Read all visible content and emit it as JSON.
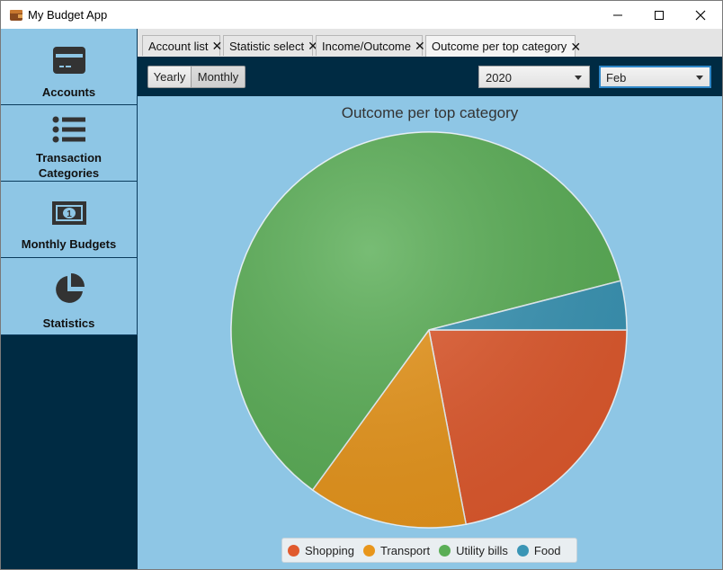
{
  "window": {
    "title": "My Budget App"
  },
  "sidebar": {
    "items": [
      {
        "label_lines": [
          "Accounts"
        ],
        "icon": "card-icon"
      },
      {
        "label_lines": [
          "Transaction",
          "Categories"
        ],
        "icon": "list-icon"
      },
      {
        "label_lines": [
          "Monthly Budgets"
        ],
        "icon": "banknote-icon"
      },
      {
        "label_lines": [
          "Statistics"
        ],
        "icon": "pie-icon"
      }
    ]
  },
  "tabs": [
    {
      "label": "Account list"
    },
    {
      "label": "Statistic select"
    },
    {
      "label": "Income/Outcome"
    },
    {
      "label": "Outcome per top category",
      "active": true
    }
  ],
  "toolbar": {
    "yearly_label": "Yearly",
    "monthly_label": "Monthly",
    "year_value": "2020",
    "month_value": "Feb"
  },
  "chart_data": {
    "type": "pie",
    "title": "Outcome per top category",
    "slices": [
      {
        "name": "Shopping",
        "value": 22,
        "color": "#e05a2e"
      },
      {
        "name": "Transport",
        "value": 13,
        "color": "#e8961c"
      },
      {
        "name": "Utility bills",
        "value": 61,
        "color": "#5aae56"
      },
      {
        "name": "Food",
        "value": 4,
        "color": "#3a95b5"
      }
    ],
    "legend_position": "bottom"
  },
  "colors": {
    "sidebar_bg": "#002b43",
    "panel_bg": "#8ec6e5"
  }
}
